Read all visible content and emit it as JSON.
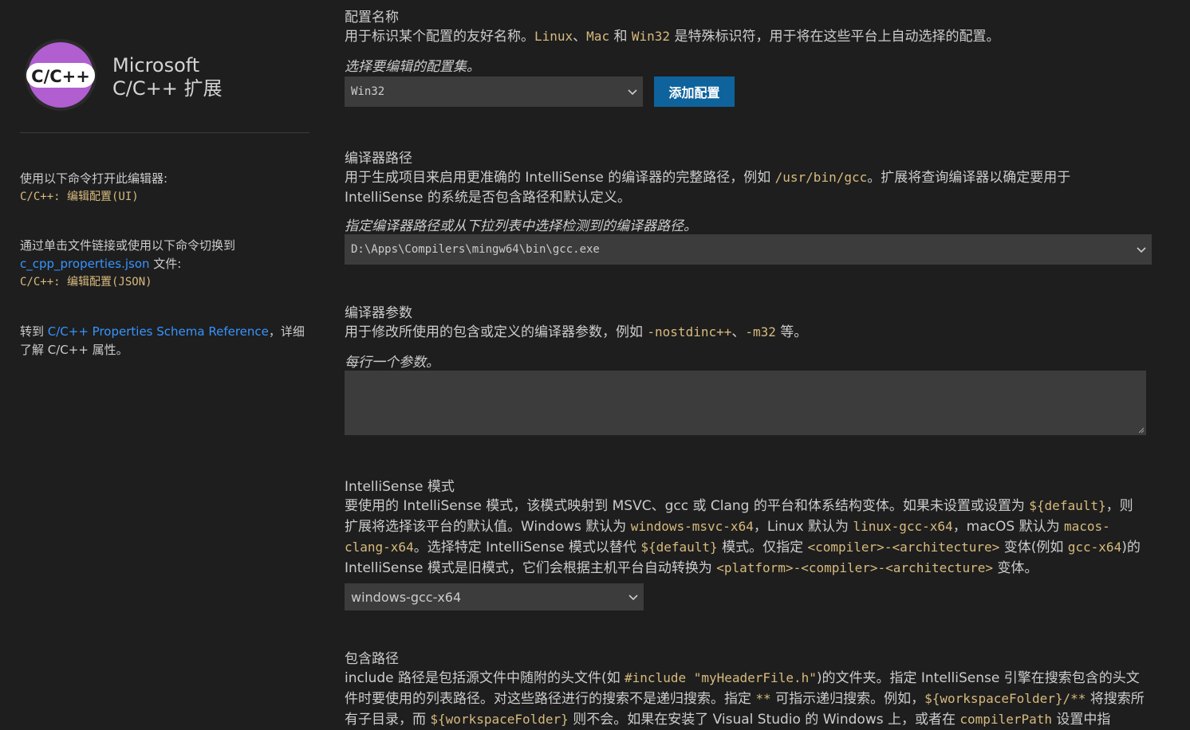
{
  "sidebar": {
    "logo_text": "C/C++",
    "title_line1": "Microsoft",
    "title_line2": "C/C++ 扩展",
    "block1_text": "使用以下命令打开此编辑器:",
    "block1_cmd": "C/C++: 编辑配置(UI)",
    "block2_text": "通过单击文件链接或使用以下命令切换到",
    "block2_link": "c_cpp_properties.json",
    "block2_suffix": " 文件:",
    "block2_cmd": "C/C++: 编辑配置(JSON)",
    "block3_prefix": "转到 ",
    "block3_link": "C/C++ Properties Schema Reference",
    "block3_mid": "，详细",
    "block3_suffix": "了解 C/C++ 属性。"
  },
  "config_name": {
    "title": "配置名称",
    "desc_prefix": "用于标识某个配置的友好名称。",
    "code1": "Linux",
    "sep1": "、",
    "code2": "Mac",
    "mid": " 和 ",
    "code3": "Win32",
    "desc_suffix": " 是特殊标识符，用于将在这些平台上自动选择的配置。",
    "hint": "选择要编辑的配置集。",
    "selected": "Win32",
    "add_button": "添加配置"
  },
  "compiler_path": {
    "title": "编译器路径",
    "desc_prefix": "用于生成项目来启用更准确的 IntelliSense 的编译器的完整路径，例如 ",
    "code1": "/usr/bin/gcc",
    "desc_suffix": "。扩展将查询编译器以确定要用于",
    "desc_line2": "IntelliSense 的系统是否包含路径和默认定义。",
    "hint": "指定编译器路径或从下拉列表中选择检测到的编译器路径。",
    "value": "D:\\Apps\\Compilers\\mingw64\\bin\\gcc.exe"
  },
  "compiler_args": {
    "title": "编译器参数",
    "desc_prefix": "用于修改所使用的包含或定义的编译器参数，例如 ",
    "code1": "-nostdinc++",
    "sep": "、",
    "code2": "-m32",
    "desc_suffix": " 等。",
    "hint": "每行一个参数。",
    "value": ""
  },
  "intellisense_mode": {
    "title": "IntelliSense 模式",
    "t1": "要使用的 IntelliSense 模式，该模式映射到 MSVC、gcc 或 Clang 的平台和体系结构变体。如果未设置或设置为 ",
    "c1": "${default}",
    "t2": "，则扩展将选择该平台的默认值。Windows 默认为 ",
    "c2": "windows-msvc-x64",
    "t3": "，Linux 默认为 ",
    "c3": "linux-gcc-x64",
    "t4": "，macOS 默认为 ",
    "c4": "macos-clang-x64",
    "t5": "。选择特定 IntelliSense 模式以替代 ",
    "c5": "${default}",
    "t6": " 模式。仅指定 ",
    "c6": "<compiler>-<architecture>",
    "t7": " 变体(例如 ",
    "c7": "gcc-x64",
    "t8": ")的 IntelliSense 模式是旧模式，它们会根据主机平台自动转换为 ",
    "c8": "<platform>-<compiler>-<architecture>",
    "t9": " 变体。",
    "selected": "windows-gcc-x64"
  },
  "include_path": {
    "title": "包含路径",
    "t1": "include 路径是包括源文件中随附的头文件(如 ",
    "c1": "#include \"myHeaderFile.h\"",
    "t2": ")的文件夹。指定 IntelliSense 引擎在搜索包含的头文件时要使用的列表路径。对这些路径进行的搜索不是递归搜索。指定 ",
    "c2": "**",
    "t3": " 可指示递归搜索。例如，",
    "c3": "${workspaceFolder}/**",
    "t4": " 将搜索所有子目录，而 ",
    "c4": "${workspaceFolder}",
    "t5": " 则不会。如果在安装了 Visual Studio 的 Windows 上，或者在 ",
    "c5": "compilerPath",
    "t6": " 设置中指"
  },
  "colors": {
    "background": "#1e1e1e",
    "text": "#cccccc",
    "code": "#d7ba7d",
    "link": "#3794ff",
    "button": "#0e639c",
    "input_bg": "#3c3c3c",
    "logo_purple": "#a855c7"
  }
}
